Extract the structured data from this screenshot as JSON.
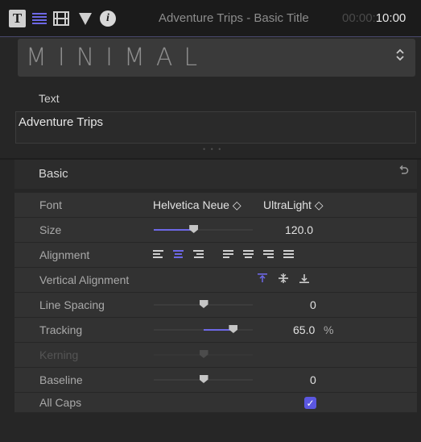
{
  "topbar": {
    "icons": [
      "text-inspector-icon",
      "lines-icon",
      "filmstrip-icon",
      "shape-icon",
      "info-icon"
    ],
    "t_glyph": "T",
    "info_glyph": "i",
    "title": "Adventure Trips - Basic Title",
    "timecode_dim": "00:00:",
    "timecode_bright": "10:00"
  },
  "preset": {
    "name": "MINIMAL",
    "arrows": "⌃⌄"
  },
  "text_section": {
    "label": "Text",
    "value": "Adventure Trips",
    "dots": "• • •"
  },
  "basic": {
    "label": "Basic",
    "reset_glyph": "↶"
  },
  "params": {
    "font": {
      "label": "Font",
      "family": "Helvetica Neue ◇",
      "weight": "UltraLight ◇"
    },
    "size": {
      "label": "Size",
      "value": "120.0",
      "slider": 0.4
    },
    "alignment": {
      "label": "Alignment",
      "selected": "center"
    },
    "vertical_alignment": {
      "label": "Vertical Alignment",
      "selected": "top"
    },
    "line_spacing": {
      "label": "Line Spacing",
      "value": "0",
      "slider": 0.5
    },
    "tracking": {
      "label": "Tracking",
      "value": "65.0",
      "unit": "%",
      "slider": 0.8
    },
    "kerning": {
      "label": "Kerning",
      "slider": 0.5
    },
    "baseline": {
      "label": "Baseline",
      "value": "0",
      "slider": 0.5
    },
    "all_caps": {
      "label": "All Caps",
      "checked": true,
      "check_glyph": "✓"
    }
  },
  "colors": {
    "accent": "#6d68e6",
    "checkbox": "#5b57e0"
  }
}
